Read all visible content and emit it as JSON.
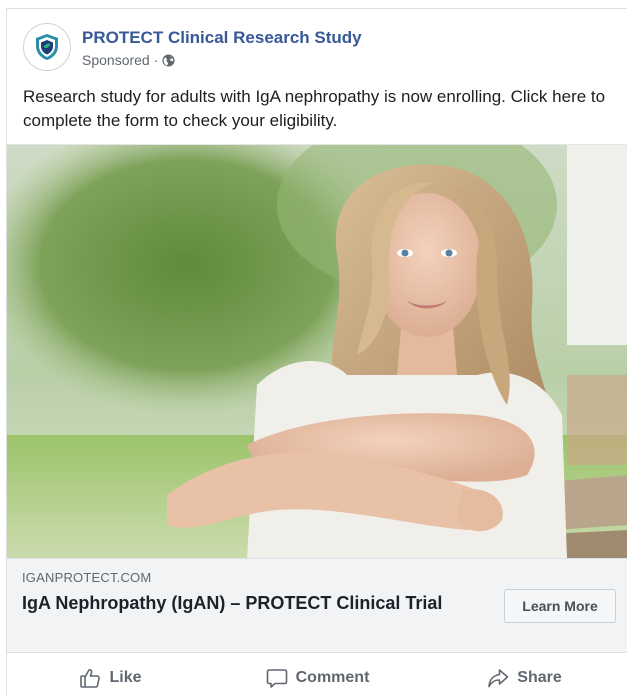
{
  "post": {
    "page_name": "PROTECT Clinical Research Study",
    "sponsored_label": "Sponsored",
    "separator": "·",
    "text": "Research study for adults with IgA nephropathy is now enrolling. Click here to complete the form to check your eligibility."
  },
  "link": {
    "domain": "IGANPROTECT.COM",
    "headline": "IgA Nephropathy (IgAN) – PROTECT Clinical Trial",
    "cta_label": "Learn More"
  },
  "actions": {
    "like": "Like",
    "comment": "Comment",
    "share": "Share"
  },
  "colors": {
    "page_name": "#385898",
    "accent_green": "#2bb673",
    "accent_teal": "#2a8fa6"
  },
  "icons": {
    "avatar": "shield-logo-icon",
    "audience": "globe-icon",
    "like": "thumbs-up-icon",
    "comment": "comment-bubble-icon",
    "share": "share-arrow-icon"
  }
}
